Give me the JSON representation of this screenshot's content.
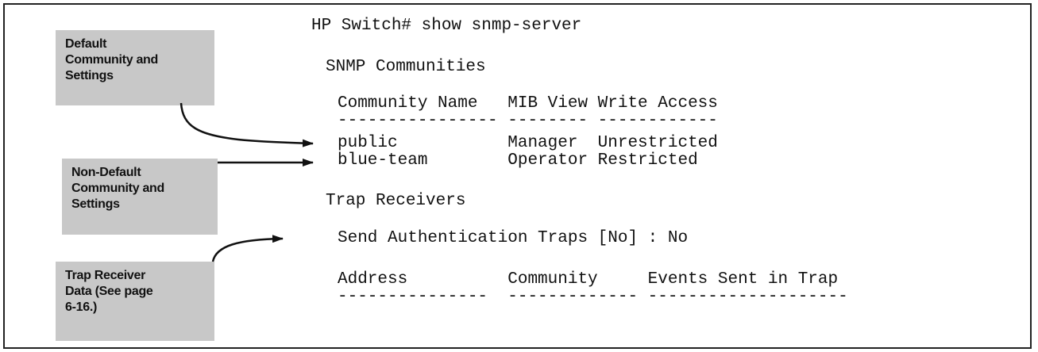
{
  "callouts": {
    "default": "Default\nCommunity and\nSettings",
    "non_default": "Non-Default\nCommunity and\nSettings",
    "trap": "Trap Receiver\nData (See page\n6-16.)"
  },
  "cli": {
    "prompt": "HP Switch# show snmp-server",
    "communities_title": "SNMP Communities",
    "communities_header": "Community Name   MIB View Write Access",
    "communities_rule": "---------------- -------- ------------",
    "row_public": "public           Manager  Unrestricted",
    "row_blue": "blue-team        Operator Restricted",
    "trap_title": "Trap Receivers",
    "auth_traps": "Send Authentication Traps [No] : No",
    "trap_header": "Address          Community     Events Sent in Trap",
    "trap_rule": "---------------  ------------- --------------------"
  }
}
